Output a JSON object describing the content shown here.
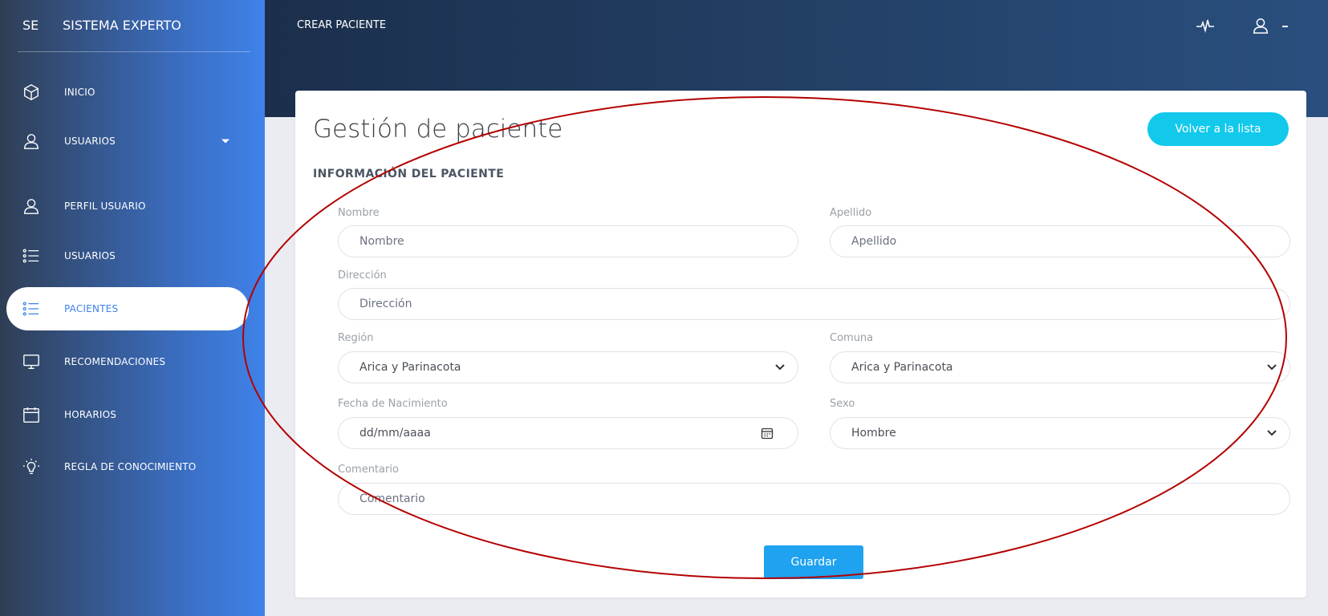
{
  "sidebar": {
    "brand_short": "SE",
    "brand_name": "SISTEMA EXPERTO",
    "items": [
      {
        "label": "INICIO",
        "icon": "box-icon"
      },
      {
        "label": "USUARIOS",
        "icon": "user-icon"
      },
      {
        "label": "PERFIL USUARIO",
        "icon": "user-icon"
      },
      {
        "label": "USUARIOS",
        "icon": "list-icon"
      },
      {
        "label": "PACIENTES",
        "icon": "list-icon"
      },
      {
        "label": "RECOMENDACIONES",
        "icon": "monitor-icon"
      },
      {
        "label": "HORARIOS",
        "icon": "calendar-icon"
      },
      {
        "label": "REGLA DE CONOCIMIENTO",
        "icon": "lightbulb-icon"
      }
    ],
    "active_item": "PACIENTES"
  },
  "header": {
    "title": "CREAR PACIENTE",
    "icons": [
      "pulse-icon",
      "user-icon"
    ]
  },
  "card": {
    "title": "Gestión de paciente",
    "back_button": "Volver a la lista",
    "section_title": "INFORMACIÓN DEL PACIENTE",
    "fields": {
      "nombre": {
        "label": "Nombre",
        "placeholder": "Nombre"
      },
      "apellido": {
        "label": "Apellido",
        "placeholder": "Apellido"
      },
      "direccion": {
        "label": "Dirección",
        "placeholder": "Dirección"
      },
      "region": {
        "label": "Región",
        "value": "Arica y Parinacota"
      },
      "comuna": {
        "label": "Comuna",
        "value": "Arica y Parinacota"
      },
      "fecha": {
        "label": "Fecha de Nacimiento",
        "placeholder": "dd/mm/aaaa"
      },
      "sexo": {
        "label": "Sexo",
        "value": "Hombre"
      },
      "comentario": {
        "label": "Comentario",
        "placeholder": "Comentario"
      }
    },
    "save_button": "Guardar"
  },
  "colors": {
    "accent_cyan": "#12c9ec",
    "save_blue": "#1fa2f0",
    "sidebar_blue": "#3f82ea",
    "annotation_red": "#b40000"
  }
}
